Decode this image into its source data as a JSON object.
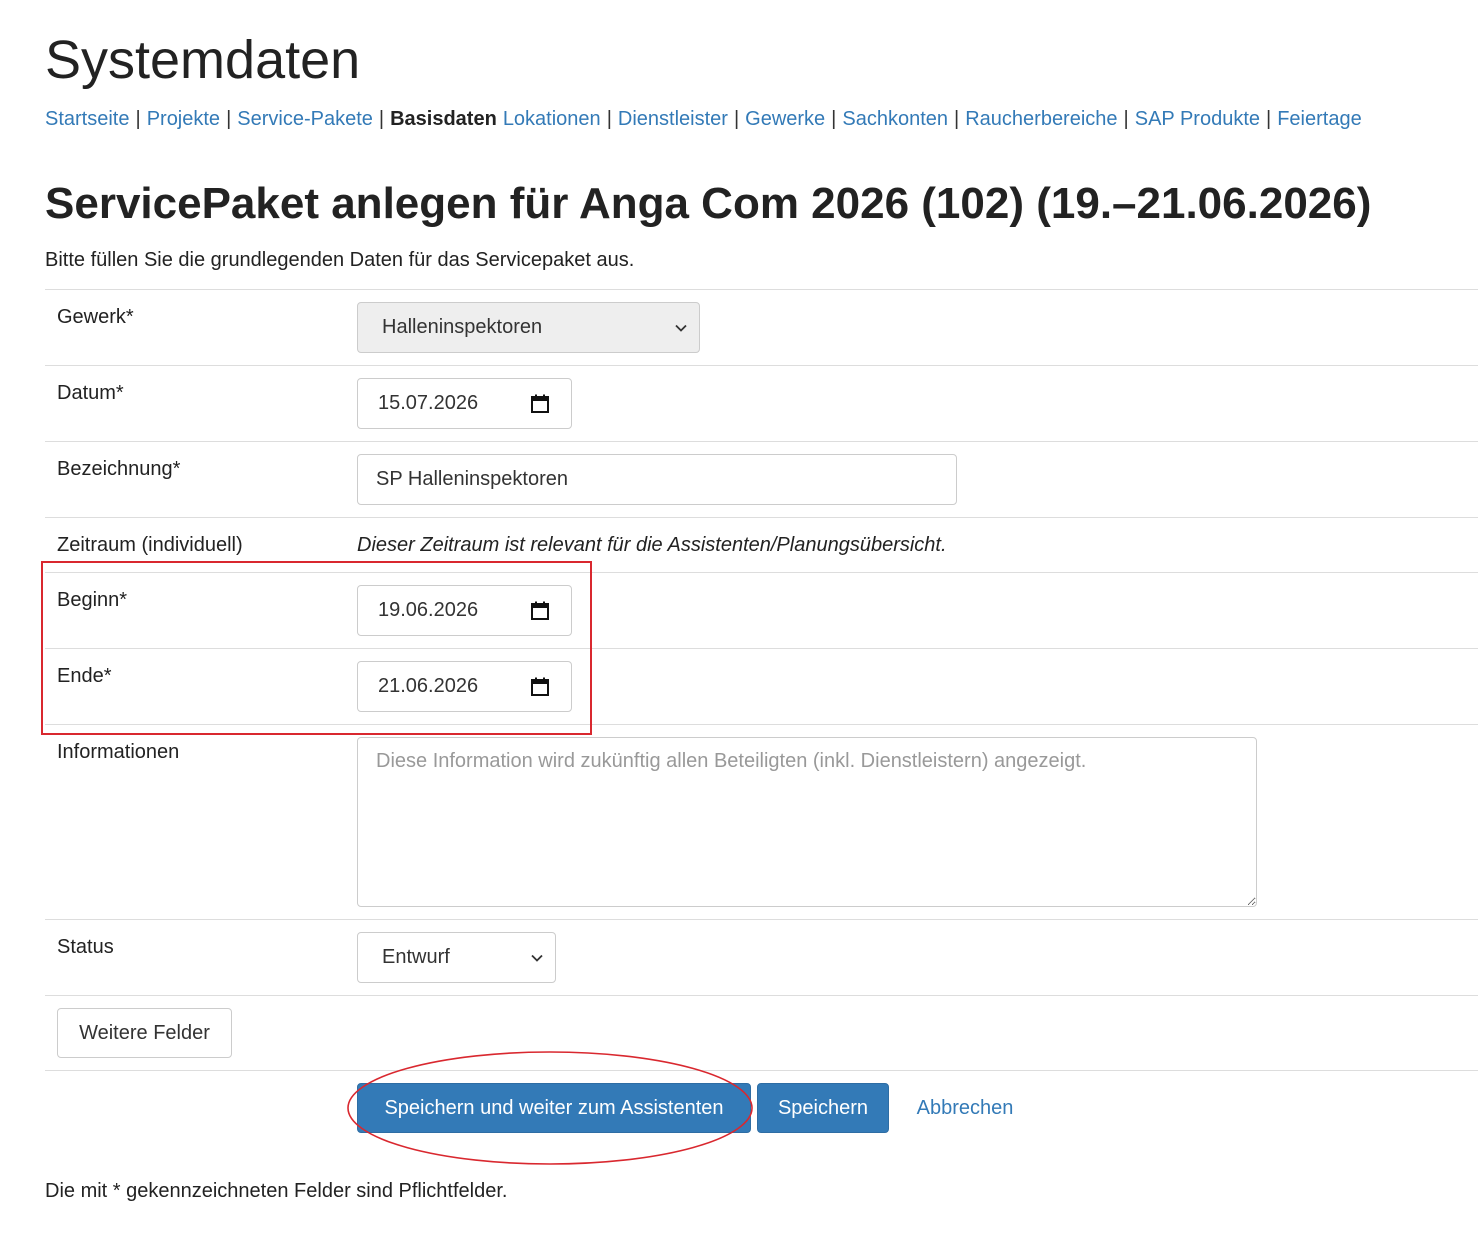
{
  "page": {
    "title": "Systemdaten",
    "subtitle": "ServicePaket anlegen für Anga Com 2026 (102) (19.–21.06.2026)",
    "lead": "Bitte füllen Sie die grundlegenden Daten für das Servicepaket aus.",
    "footnote": "Die mit * gekennzeichneten Felder sind Pflichtfelder."
  },
  "nav": {
    "separator": "|",
    "items": [
      {
        "label": "Startseite"
      },
      {
        "label": "Projekte"
      },
      {
        "label": "Service-Pakete"
      },
      {
        "label": "Basisdaten",
        "active": true
      },
      {
        "label": "Lokationen"
      },
      {
        "label": "Dienstleister"
      },
      {
        "label": "Gewerke"
      },
      {
        "label": "Sachkonten"
      },
      {
        "label": "Raucherbereiche"
      },
      {
        "label": "SAP Produkte"
      },
      {
        "label": "Feiertage"
      }
    ]
  },
  "form": {
    "gewerk": {
      "label": "Gewerk*",
      "value": "Halleninspektoren"
    },
    "datum": {
      "label": "Datum*",
      "value": "15.07.2026"
    },
    "bezeichnung": {
      "label": "Bezeichnung*",
      "value": "SP Halleninspektoren"
    },
    "zeitraum": {
      "label": "Zeitraum (individuell)",
      "hint": "Dieser Zeitraum ist relevant für die Assistenten/Planungsübersicht."
    },
    "beginn": {
      "label": "Beginn*",
      "value": "19.06.2026"
    },
    "ende": {
      "label": "Ende*",
      "value": "21.06.2026"
    },
    "informationen": {
      "label": "Informationen",
      "placeholder": "Diese Information wird zukünftig allen Beteiligten (inkl. Dienstleistern) angezeigt."
    },
    "status": {
      "label": "Status",
      "value": "Entwurf"
    }
  },
  "buttons": {
    "weitere": "Weitere Felder",
    "save_assistant": "Speichern und weiter zum Assistenten",
    "save": "Speichern",
    "cancel": "Abbrechen"
  },
  "colors": {
    "link": "#337ab7",
    "primary": "#337ab7",
    "highlight": "#d9282f"
  }
}
